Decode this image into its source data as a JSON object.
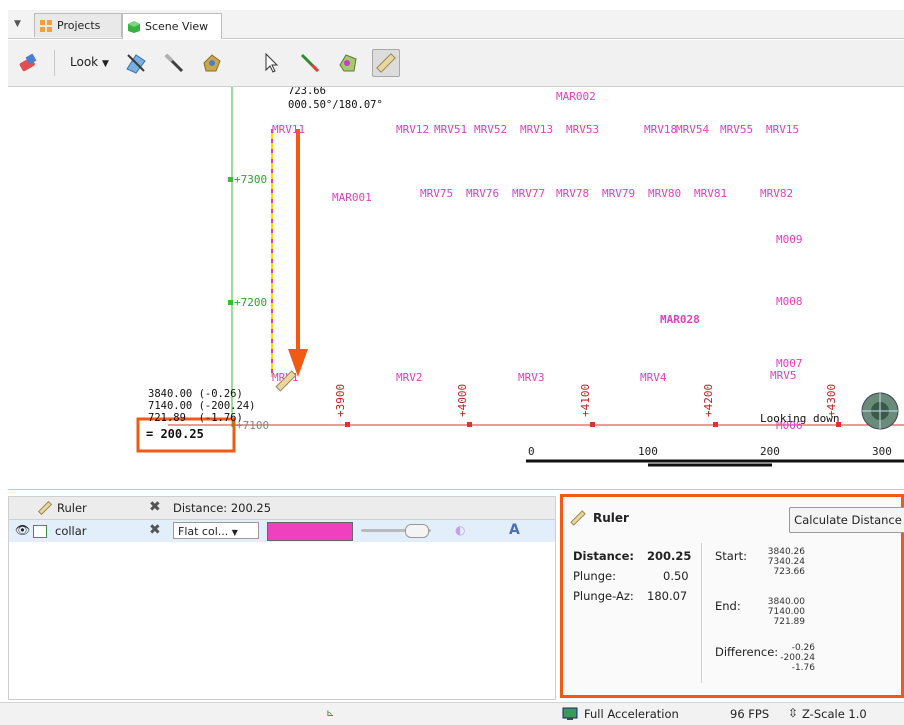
{
  "tabs": [
    {
      "label": "Projects",
      "icon": "grid-icon"
    },
    {
      "label": "Scene View",
      "icon": "cube-icon"
    }
  ],
  "toolbar": {
    "look_label": "Look"
  },
  "scene": {
    "top_readout": [
      "723.66",
      "000.50°/180.07°"
    ],
    "ruler_coords": [
      "3840.00 (-0.26)",
      "7140.00 (-200.24)",
      "721.89  (-1.76)"
    ],
    "distance_readout": "= 200.25",
    "looking_label": "Looking down",
    "grid_left": [
      "+7300",
      "+7200",
      "+7100"
    ],
    "grid_bottom": [
      "+3900",
      "+4000",
      "+4100",
      "+4200",
      "+4300"
    ],
    "scale_labels": [
      "0",
      "100",
      "200",
      "300"
    ],
    "markers": [
      "MAR002",
      "MRV11",
      "MRV12",
      "MRV51",
      "MRV52",
      "MRV13",
      "MRV53",
      "MRV18",
      "MRV54",
      "MRV55",
      "MRV15",
      "MAR001",
      "MRV75",
      "MRV76",
      "MRV77",
      "MRV78",
      "MRV79",
      "MRV80",
      "MRV81",
      "MRV82",
      "M009",
      "M008",
      "MAR028",
      "M007",
      "MRV5",
      "MRV1",
      "MRV2",
      "MRV3",
      "MRV4",
      "M006"
    ]
  },
  "objects_panel": {
    "header_item": "Ruler",
    "header_distance": "Distance: 200.25",
    "row_name": "collar",
    "color_mode": "Flat col...",
    "color_swatch": "#f040c0"
  },
  "ruler_panel": {
    "title": "Ruler",
    "calc_button": "Calculate Distance",
    "distance_label": "Distance:",
    "distance_value": "200.25",
    "plunge_label": "Plunge:",
    "plunge_value": "0.50",
    "plunge_az_label": "Plunge-Az:",
    "plunge_az_value": "180.07",
    "start_label": "Start:",
    "start_values": [
      "3840.26",
      "7340.24",
      "723.66"
    ],
    "end_label": "End:",
    "end_values": [
      "3840.00",
      "7140.00",
      "721.89"
    ],
    "difference_label": "Difference:",
    "difference_values": [
      "-0.26",
      "-200.24",
      "-1.76"
    ]
  },
  "statusbar": {
    "acceleration": "Full Acceleration",
    "fps": "96 FPS",
    "zscale": "Z-Scale 1.0"
  },
  "colors": {
    "accent_orange": "#f05a14",
    "marker_pink": "#e040c0",
    "grid_red": "#e03030",
    "grid_green": "#30c030"
  }
}
